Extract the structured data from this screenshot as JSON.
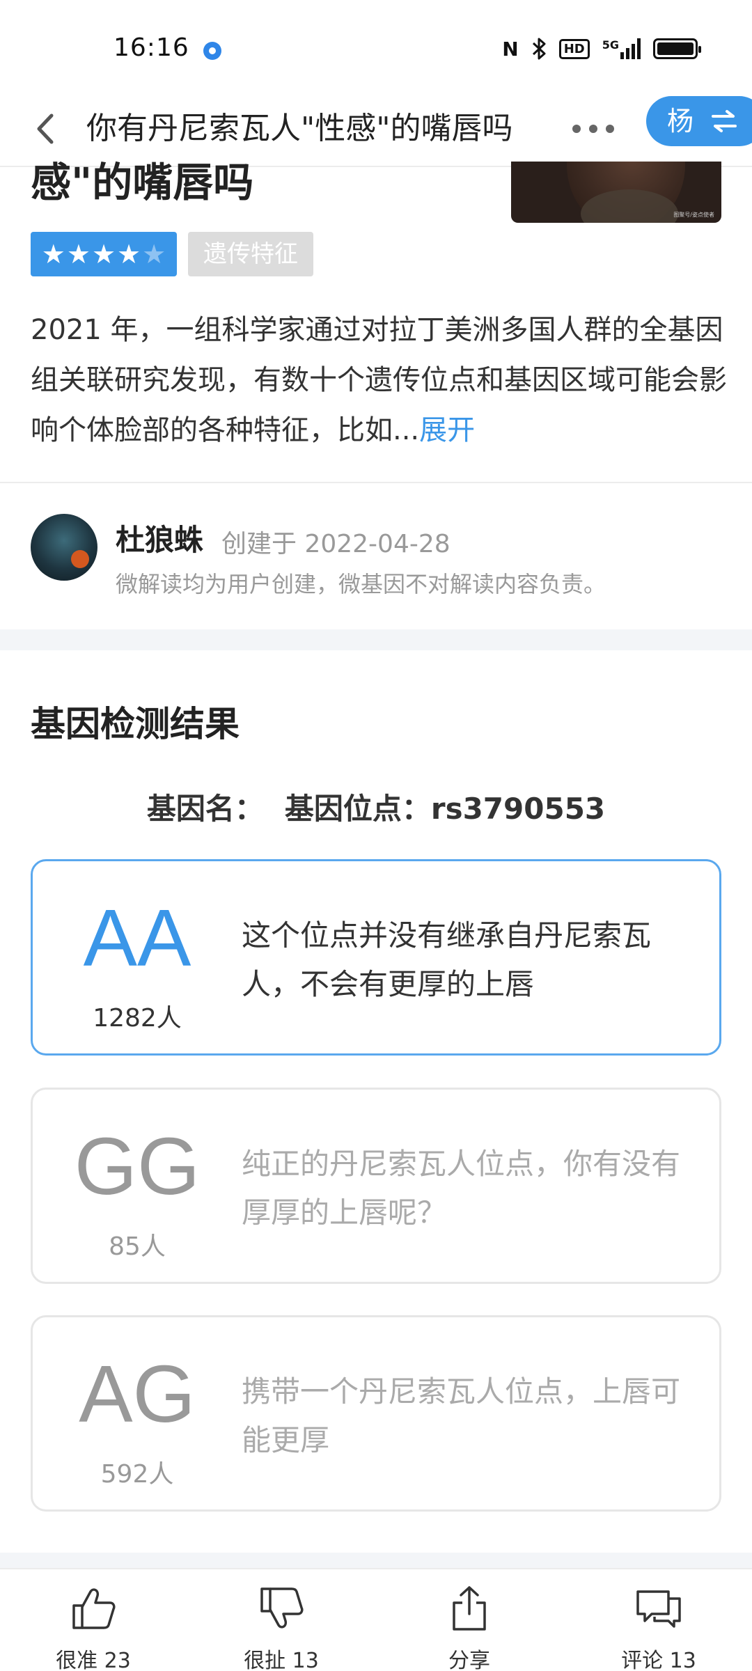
{
  "status_bar": {
    "time": "16:16",
    "network": "5G",
    "hd": "HD"
  },
  "header": {
    "title": "你有丹尼索瓦人\"性感\"的嘴唇吗",
    "user_initial": "杨"
  },
  "article": {
    "title_tail": "感\"的嘴唇吗",
    "rating_stars": 4.5,
    "tag": "遗传特征",
    "description": "2021 年，一组科学家通过对拉丁美洲多国人群的全基因组关联研究发现，有数十个遗传位点和基因区域可能会影响个体脸部的各种特征，比如...",
    "expand_label": "展开",
    "image_caption": "图聚号/姿点使者"
  },
  "author": {
    "name": "杜狼蛛",
    "created": "创建于 2022-04-28",
    "disclaimer": "微解读均为用户创建，微基因不对解读内容负责。"
  },
  "results": {
    "section_title": "基因检测结果",
    "gene_name_label": "基因名：",
    "gene_locus_label": "基因位点：rs3790553",
    "items": [
      {
        "genotype": "AA",
        "count": "1282人",
        "text": "这个位点并没有继承自丹尼索瓦人，不会有更厚的上唇",
        "selected": true
      },
      {
        "genotype": "GG",
        "count": "85人",
        "text": "纯正的丹尼索瓦人位点，你有没有厚厚的上唇呢？",
        "selected": false
      },
      {
        "genotype": "AG",
        "count": "592人",
        "text": "携带一个丹尼索瓦人位点，上唇可能更厚",
        "selected": false
      }
    ]
  },
  "bottom_bar": {
    "like_label": "很准 23",
    "dislike_label": "很扯 13",
    "share_label": "分享",
    "comment_label": "评论 13"
  },
  "colors": {
    "accent": "#3a96e8",
    "tag_bg": "#dcdcdc",
    "divider": "#f3f5f8"
  }
}
